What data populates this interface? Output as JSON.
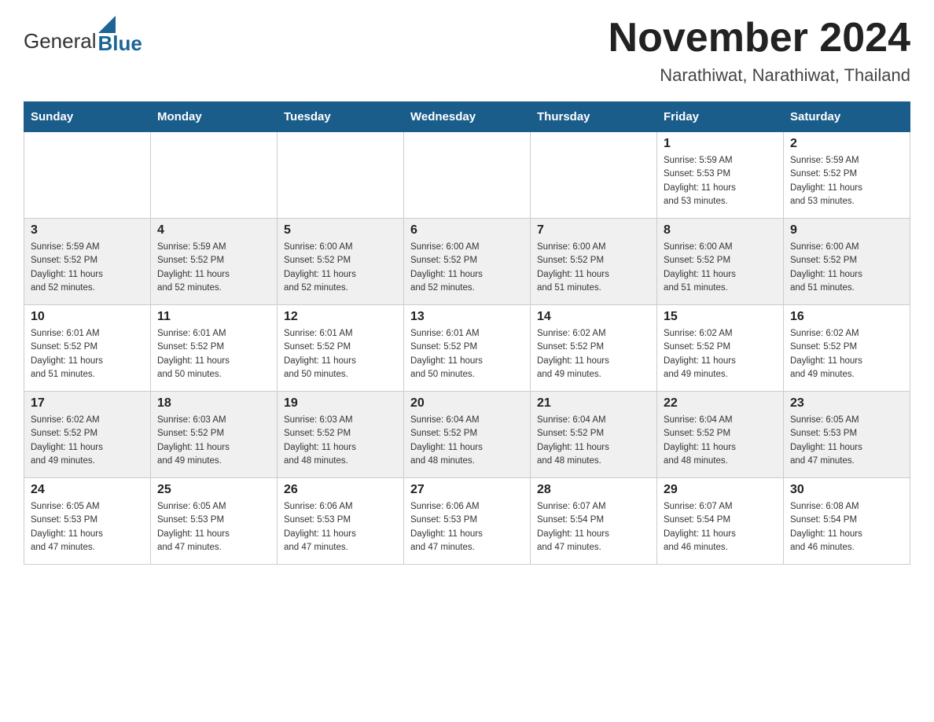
{
  "header": {
    "logo_general": "General",
    "logo_blue": "Blue",
    "month_title": "November 2024",
    "location": "Narathiwat, Narathiwat, Thailand"
  },
  "days_of_week": [
    "Sunday",
    "Monday",
    "Tuesday",
    "Wednesday",
    "Thursday",
    "Friday",
    "Saturday"
  ],
  "weeks": [
    {
      "days": [
        {
          "date": "",
          "info": ""
        },
        {
          "date": "",
          "info": ""
        },
        {
          "date": "",
          "info": ""
        },
        {
          "date": "",
          "info": ""
        },
        {
          "date": "",
          "info": ""
        },
        {
          "date": "1",
          "info": "Sunrise: 5:59 AM\nSunset: 5:53 PM\nDaylight: 11 hours\nand 53 minutes."
        },
        {
          "date": "2",
          "info": "Sunrise: 5:59 AM\nSunset: 5:52 PM\nDaylight: 11 hours\nand 53 minutes."
        }
      ]
    },
    {
      "days": [
        {
          "date": "3",
          "info": "Sunrise: 5:59 AM\nSunset: 5:52 PM\nDaylight: 11 hours\nand 52 minutes."
        },
        {
          "date": "4",
          "info": "Sunrise: 5:59 AM\nSunset: 5:52 PM\nDaylight: 11 hours\nand 52 minutes."
        },
        {
          "date": "5",
          "info": "Sunrise: 6:00 AM\nSunset: 5:52 PM\nDaylight: 11 hours\nand 52 minutes."
        },
        {
          "date": "6",
          "info": "Sunrise: 6:00 AM\nSunset: 5:52 PM\nDaylight: 11 hours\nand 52 minutes."
        },
        {
          "date": "7",
          "info": "Sunrise: 6:00 AM\nSunset: 5:52 PM\nDaylight: 11 hours\nand 51 minutes."
        },
        {
          "date": "8",
          "info": "Sunrise: 6:00 AM\nSunset: 5:52 PM\nDaylight: 11 hours\nand 51 minutes."
        },
        {
          "date": "9",
          "info": "Sunrise: 6:00 AM\nSunset: 5:52 PM\nDaylight: 11 hours\nand 51 minutes."
        }
      ]
    },
    {
      "days": [
        {
          "date": "10",
          "info": "Sunrise: 6:01 AM\nSunset: 5:52 PM\nDaylight: 11 hours\nand 51 minutes."
        },
        {
          "date": "11",
          "info": "Sunrise: 6:01 AM\nSunset: 5:52 PM\nDaylight: 11 hours\nand 50 minutes."
        },
        {
          "date": "12",
          "info": "Sunrise: 6:01 AM\nSunset: 5:52 PM\nDaylight: 11 hours\nand 50 minutes."
        },
        {
          "date": "13",
          "info": "Sunrise: 6:01 AM\nSunset: 5:52 PM\nDaylight: 11 hours\nand 50 minutes."
        },
        {
          "date": "14",
          "info": "Sunrise: 6:02 AM\nSunset: 5:52 PM\nDaylight: 11 hours\nand 49 minutes."
        },
        {
          "date": "15",
          "info": "Sunrise: 6:02 AM\nSunset: 5:52 PM\nDaylight: 11 hours\nand 49 minutes."
        },
        {
          "date": "16",
          "info": "Sunrise: 6:02 AM\nSunset: 5:52 PM\nDaylight: 11 hours\nand 49 minutes."
        }
      ]
    },
    {
      "days": [
        {
          "date": "17",
          "info": "Sunrise: 6:02 AM\nSunset: 5:52 PM\nDaylight: 11 hours\nand 49 minutes."
        },
        {
          "date": "18",
          "info": "Sunrise: 6:03 AM\nSunset: 5:52 PM\nDaylight: 11 hours\nand 49 minutes."
        },
        {
          "date": "19",
          "info": "Sunrise: 6:03 AM\nSunset: 5:52 PM\nDaylight: 11 hours\nand 48 minutes."
        },
        {
          "date": "20",
          "info": "Sunrise: 6:04 AM\nSunset: 5:52 PM\nDaylight: 11 hours\nand 48 minutes."
        },
        {
          "date": "21",
          "info": "Sunrise: 6:04 AM\nSunset: 5:52 PM\nDaylight: 11 hours\nand 48 minutes."
        },
        {
          "date": "22",
          "info": "Sunrise: 6:04 AM\nSunset: 5:52 PM\nDaylight: 11 hours\nand 48 minutes."
        },
        {
          "date": "23",
          "info": "Sunrise: 6:05 AM\nSunset: 5:53 PM\nDaylight: 11 hours\nand 47 minutes."
        }
      ]
    },
    {
      "days": [
        {
          "date": "24",
          "info": "Sunrise: 6:05 AM\nSunset: 5:53 PM\nDaylight: 11 hours\nand 47 minutes."
        },
        {
          "date": "25",
          "info": "Sunrise: 6:05 AM\nSunset: 5:53 PM\nDaylight: 11 hours\nand 47 minutes."
        },
        {
          "date": "26",
          "info": "Sunrise: 6:06 AM\nSunset: 5:53 PM\nDaylight: 11 hours\nand 47 minutes."
        },
        {
          "date": "27",
          "info": "Sunrise: 6:06 AM\nSunset: 5:53 PM\nDaylight: 11 hours\nand 47 minutes."
        },
        {
          "date": "28",
          "info": "Sunrise: 6:07 AM\nSunset: 5:54 PM\nDaylight: 11 hours\nand 47 minutes."
        },
        {
          "date": "29",
          "info": "Sunrise: 6:07 AM\nSunset: 5:54 PM\nDaylight: 11 hours\nand 46 minutes."
        },
        {
          "date": "30",
          "info": "Sunrise: 6:08 AM\nSunset: 5:54 PM\nDaylight: 11 hours\nand 46 minutes."
        }
      ]
    }
  ]
}
